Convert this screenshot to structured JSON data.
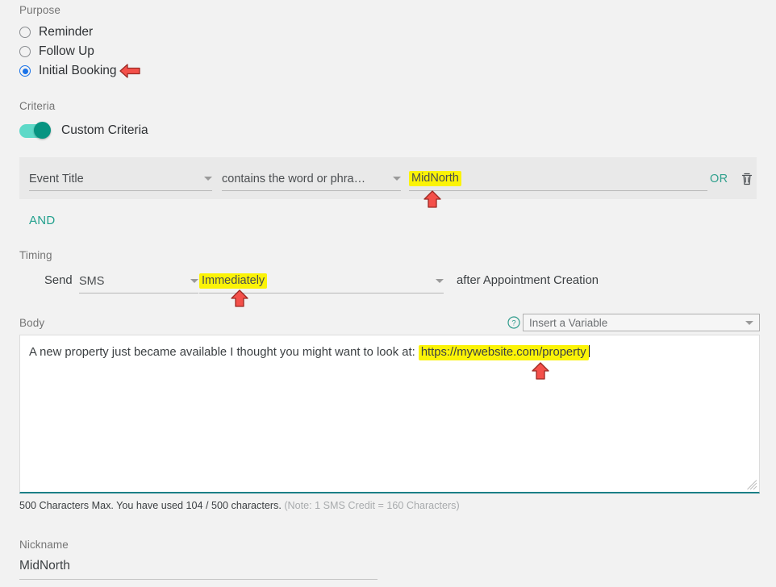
{
  "purpose": {
    "label": "Purpose",
    "options": [
      {
        "label": "Reminder",
        "selected": false
      },
      {
        "label": "Follow Up",
        "selected": false
      },
      {
        "label": "Initial Booking",
        "selected": true
      }
    ]
  },
  "criteria": {
    "label": "Criteria",
    "toggle_label": "Custom Criteria",
    "toggle_on": true,
    "row": {
      "field_value": "Event Title",
      "operator_value": "contains the word or phra…",
      "match_value": "MidNorth",
      "or_label": "OR",
      "delete_icon": "trash-icon"
    },
    "and_label": "AND"
  },
  "timing": {
    "label": "Timing",
    "send_label": "Send",
    "channel_value": "SMS",
    "when_value": "Immediately",
    "suffix_text": "after Appointment Creation"
  },
  "body": {
    "label": "Body",
    "help_icon": "help-circle-icon",
    "variable_placeholder": "Insert a Variable",
    "text_plain": "A new property just became available I thought you might want to look at: ",
    "text_highlighted": "https://mywebsite.com/property",
    "char_note_main": "500 Characters Max. You have used 104 / 500 characters.",
    "char_note_secondary": "(Note: 1 SMS Credit = 160 Characters)"
  },
  "nickname": {
    "label": "Nickname",
    "value": "MidNorth"
  },
  "colors": {
    "accent_teal": "#22a08d",
    "radio_blue": "#1a73e8",
    "highlight_yellow": "#fbf307",
    "arrow_red": "#f4504a",
    "page_background": "#f2f2f2"
  },
  "annotations": [
    {
      "name": "arrow-initial-booking",
      "direction": "left"
    },
    {
      "name": "arrow-midnorth",
      "direction": "up"
    },
    {
      "name": "arrow-immediately",
      "direction": "up"
    },
    {
      "name": "arrow-url",
      "direction": "up"
    }
  ]
}
